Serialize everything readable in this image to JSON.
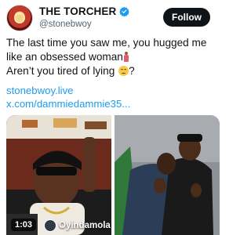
{
  "author": {
    "display_name": "THE TORCHER",
    "handle": "@stonebwoy",
    "avatar_icon": "avatar-image",
    "verified_icon": "verified-badge-icon"
  },
  "actions": {
    "follow_label": "Follow"
  },
  "tweet": {
    "line1": "The last time you saw me, you hugged me",
    "line2": "like an obsessed woman",
    "line3": "Aren’t you tired of lying",
    "line3_end": "?",
    "emojis": [
      "woman-standing-emoji",
      "face-with-rolling-eyes-emoji"
    ]
  },
  "links": [
    "stonebwoy.live",
    "x.com/dammiedammie35..."
  ],
  "media": {
    "video_duration": "1:03",
    "uploader_name": "Oyindamola",
    "left_image": "man-with-sunglasses-and-braids-photo",
    "right_image": "two-men-hugging-photo"
  },
  "colors": {
    "link": "#1d9bf0",
    "text": "#0f1419",
    "secondary": "#536471",
    "follow_bg": "#0f1419",
    "verified": "#1d9bf0"
  }
}
